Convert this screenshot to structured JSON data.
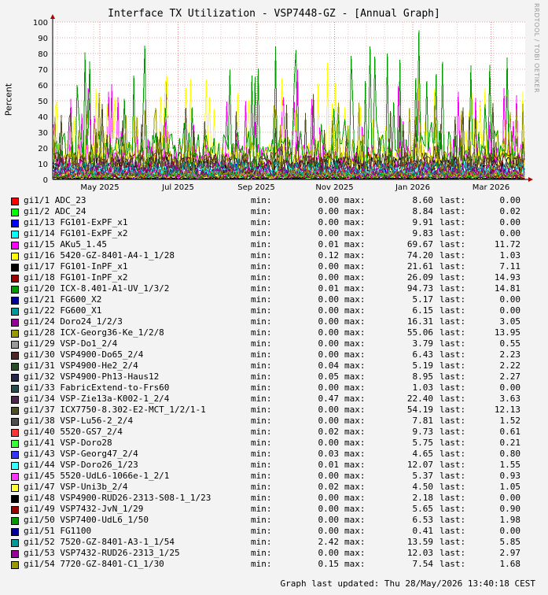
{
  "chart_data": {
    "type": "line",
    "title": "Interface TX Utilization - VSP7448-GZ - [Annual Graph]",
    "ylabel": "Percent",
    "ylim": [
      0,
      100
    ],
    "yticks": [
      0,
      10,
      20,
      30,
      40,
      50,
      60,
      70,
      80,
      90,
      100
    ],
    "xtick_labels": [
      "May 2025",
      "Jul 2025",
      "Sep 2025",
      "Nov 2025",
      "Jan 2026",
      "Mar 2026",
      "May 2026"
    ],
    "grid": true,
    "watermark": "RRDTOOL / TOBI OETIKER",
    "legend_headers": {
      "min": "min:",
      "max": "max:",
      "last": "last:"
    },
    "series": [
      {
        "name": "gi1/1 ADC_23",
        "color": "#ff0000",
        "min": "0.00",
        "max": "8.60",
        "last": "0.00"
      },
      {
        "name": "gi1/2 ADC_24",
        "color": "#00ff00",
        "min": "0.00",
        "max": "8.84",
        "last": "0.02"
      },
      {
        "name": "gi1/13 FG101-ExPF_x1",
        "color": "#0000ff",
        "min": "0.00",
        "max": "9.91",
        "last": "0.00"
      },
      {
        "name": "gi1/14 FG101-ExPF_x2",
        "color": "#00ffff",
        "min": "0.00",
        "max": "9.83",
        "last": "0.00"
      },
      {
        "name": "gi1/15 AKu5_1.45",
        "color": "#ff00ff",
        "min": "0.01",
        "max": "69.67",
        "last": "11.72"
      },
      {
        "name": "gi1/16 5420-GZ-8401-A4-1_1/28",
        "color": "#ffff00",
        "min": "0.12",
        "max": "74.20",
        "last": "1.03"
      },
      {
        "name": "gi1/17 FG101-InPF_x1",
        "color": "#000000",
        "min": "0.00",
        "max": "21.61",
        "last": "7.11"
      },
      {
        "name": "gi1/18 FG101-InPF_x2",
        "color": "#990000",
        "min": "0.00",
        "max": "26.09",
        "last": "14.93"
      },
      {
        "name": "gi1/20 ICX-8.401-A1-UV_1/3/2",
        "color": "#009900",
        "min": "0.01",
        "max": "94.73",
        "last": "14.81"
      },
      {
        "name": "gi1/21 FG600_X2",
        "color": "#000099",
        "min": "0.00",
        "max": "5.17",
        "last": "0.00"
      },
      {
        "name": "gi1/22 FG600_X1",
        "color": "#009999",
        "min": "0.00",
        "max": "6.15",
        "last": "0.00"
      },
      {
        "name": "gi1/24 Doro24_1/2/3",
        "color": "#990099",
        "min": "0.00",
        "max": "16.31",
        "last": "3.05"
      },
      {
        "name": "gi1/28 ICX-Georg36-Ke_1/2/8",
        "color": "#999900",
        "min": "0.00",
        "max": "55.06",
        "last": "13.95"
      },
      {
        "name": "gi1/29 VSP-Do1_2/4",
        "color": "#999999",
        "min": "0.00",
        "max": "3.79",
        "last": "0.55"
      },
      {
        "name": "gi1/30 VSP4900-Do65_2/4",
        "color": "#4d2626",
        "min": "0.00",
        "max": "6.43",
        "last": "2.23"
      },
      {
        "name": "gi1/31 VSP4900-He2_2/4",
        "color": "#264d26",
        "min": "0.04",
        "max": "5.19",
        "last": "2.22"
      },
      {
        "name": "gi1/32 VSP4900-Ph13-Haus12",
        "color": "#26264d",
        "min": "0.05",
        "max": "8.95",
        "last": "2.27"
      },
      {
        "name": "gi1/33 FabricExtend-to-Frs60",
        "color": "#264d4d",
        "min": "0.00",
        "max": "1.03",
        "last": "0.00"
      },
      {
        "name": "gi1/34 VSP-Zie13a-K002-1_2/4",
        "color": "#4d264d",
        "min": "0.47",
        "max": "22.40",
        "last": "3.63"
      },
      {
        "name": "gi1/37 ICX7750-8.302-E2-MCT_1/2/1-1",
        "color": "#4d4d26",
        "min": "0.00",
        "max": "54.19",
        "last": "12.13"
      },
      {
        "name": "gi1/38 VSP-Lu56-2_2/4",
        "color": "#4d4d4d",
        "min": "0.00",
        "max": "7.81",
        "last": "1.52"
      },
      {
        "name": "gi1/40 5520-GS7_2/4",
        "color": "#ff3333",
        "min": "0.02",
        "max": "9.73",
        "last": "0.61"
      },
      {
        "name": "gi1/41 VSP-Doro28",
        "color": "#33ff33",
        "min": "0.00",
        "max": "5.75",
        "last": "0.21"
      },
      {
        "name": "gi1/43 VSP-Georg47_2/4",
        "color": "#3333ff",
        "min": "0.03",
        "max": "4.65",
        "last": "0.80"
      },
      {
        "name": "gi1/44 VSP-Doro26_1/23",
        "color": "#33ffff",
        "min": "0.01",
        "max": "12.07",
        "last": "1.55"
      },
      {
        "name": "gi1/45 5520-UdL6-1066e-1_2/1",
        "color": "#ff33ff",
        "min": "0.00",
        "max": "5.37",
        "last": "0.93"
      },
      {
        "name": "gi1/47 VSP-Uni3b_2/4",
        "color": "#ffff33",
        "min": "0.02",
        "max": "4.50",
        "last": "1.05"
      },
      {
        "name": "gi1/48 VSP4900-RUD26-2313-S08-1_1/23",
        "color": "#000000",
        "min": "0.00",
        "max": "2.18",
        "last": "0.00"
      },
      {
        "name": "gi1/49 VSP7432-JvN_1/29",
        "color": "#990000",
        "min": "0.00",
        "max": "5.65",
        "last": "0.90"
      },
      {
        "name": "gi1/50 VSP7400-UdL6_1/50",
        "color": "#009900",
        "min": "0.00",
        "max": "6.53",
        "last": "1.98"
      },
      {
        "name": "gi1/51 FG1100",
        "color": "#000099",
        "min": "0.00",
        "max": "0.41",
        "last": "0.00"
      },
      {
        "name": "gi1/52 7520-GZ-8401-A3-1_1/54",
        "color": "#009999",
        "min": "2.42",
        "max": "13.59",
        "last": "5.85"
      },
      {
        "name": "gi1/53 VSP7432-RUD26-2313_1/25",
        "color": "#990099",
        "min": "0.00",
        "max": "12.03",
        "last": "2.97"
      },
      {
        "name": "gi1/54 7720-GZ-8401-C1_1/30",
        "color": "#999900",
        "min": "0.15",
        "max": "7.54",
        "last": "1.68"
      }
    ]
  },
  "footer": {
    "updated": "Graph last updated: Thu 28/May/2026 13:40:18 CEST"
  }
}
